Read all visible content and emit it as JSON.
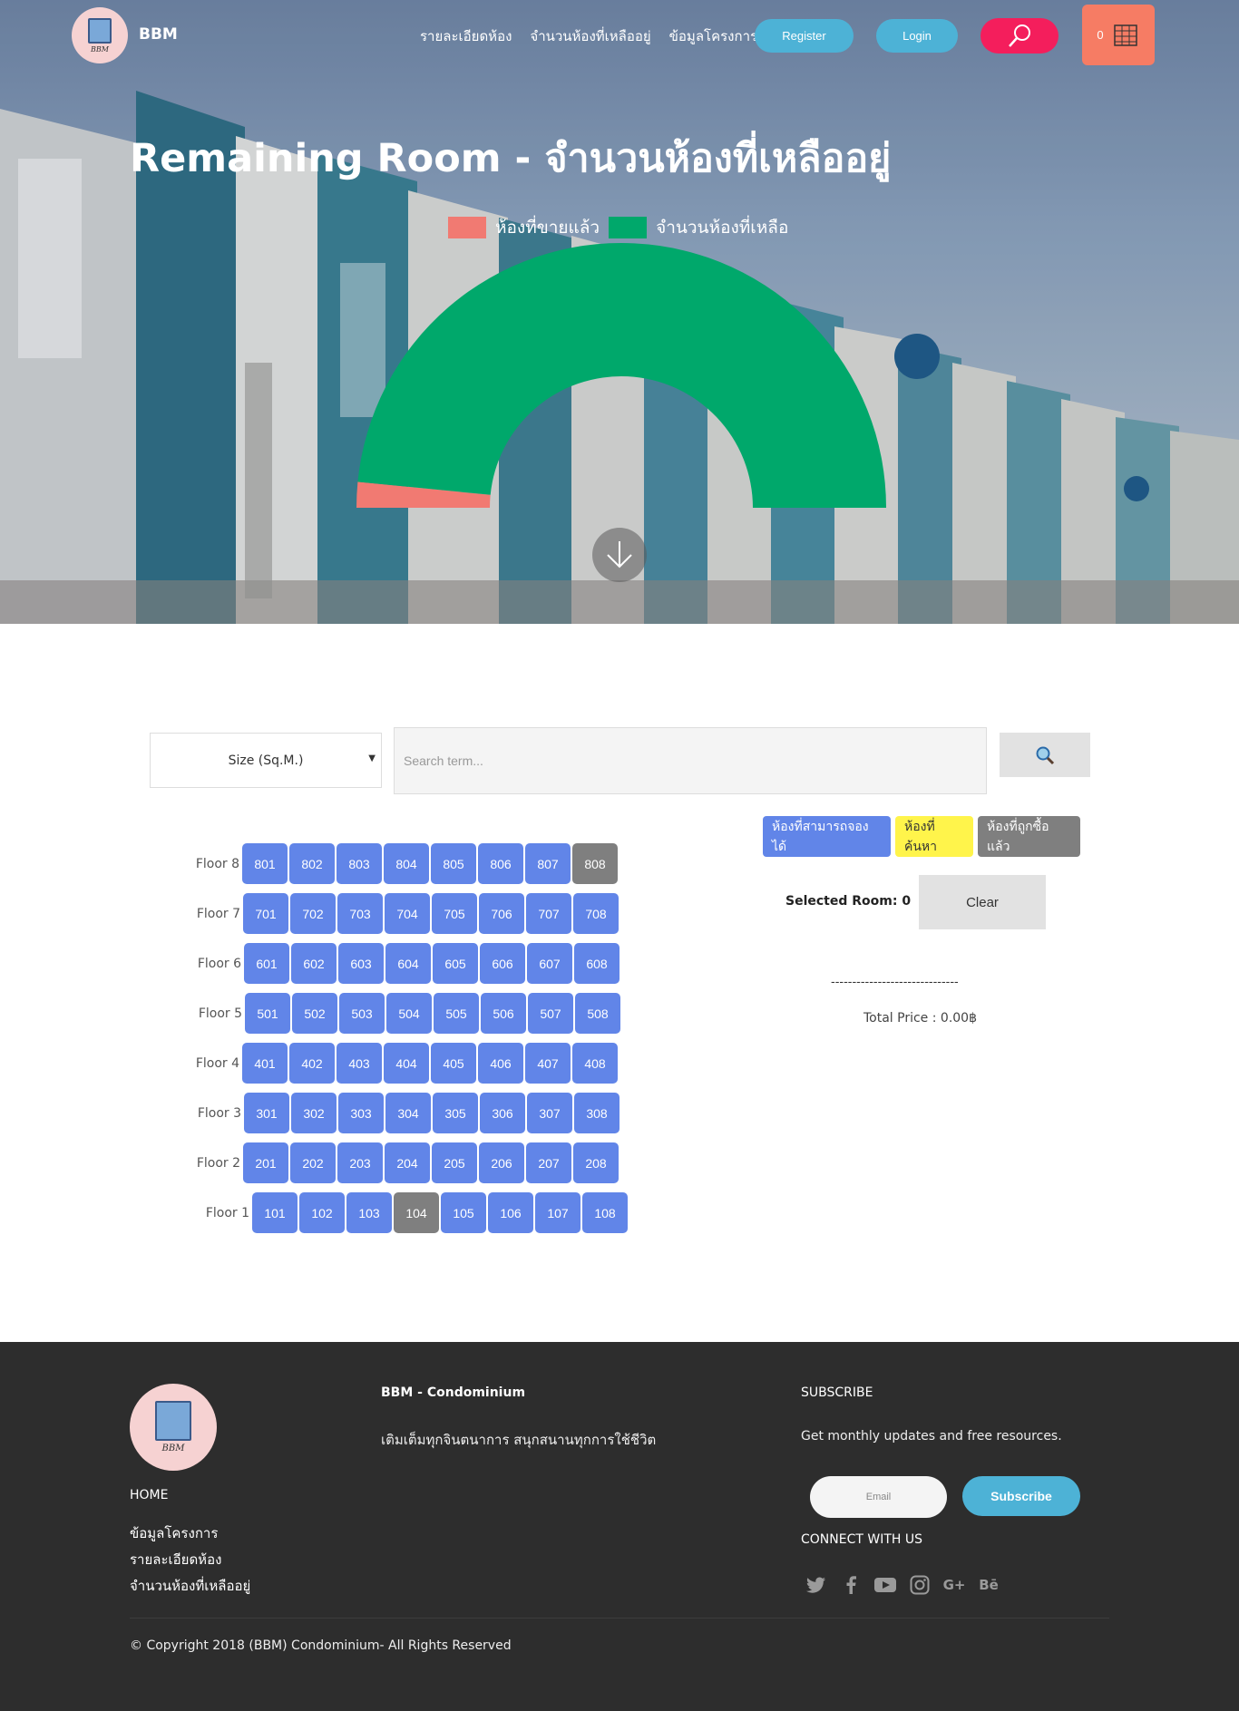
{
  "nav": {
    "brand": "BBM",
    "links": [
      "รายละเอียดห้อง",
      "จำนวนห้องที่เหลืออยู่",
      "ข้อมูลโครงการ"
    ],
    "register": "Register",
    "login": "Login",
    "cart_count": "0"
  },
  "hero": {
    "title": "Remaining Room - จำนวนห้องที่เหลืออยู่",
    "legend": [
      {
        "label": "ห้องที่ขายแล้ว",
        "color": "#f17a72"
      },
      {
        "label": "จำนวนห้องที่เหลือ",
        "color": "#00a86b"
      }
    ]
  },
  "chart_data": {
    "type": "pie",
    "subtype": "half-doughnut",
    "series": [
      {
        "name": "ห้องที่ขายแล้ว",
        "value": 2,
        "color": "#f17a72"
      },
      {
        "name": "จำนวนห้องที่เหลือ",
        "value": 62,
        "color": "#00a86b"
      }
    ]
  },
  "search": {
    "size_label": "Size (Sq.M.)",
    "placeholder": "Search term..."
  },
  "floors": [
    {
      "label": "Floor 8",
      "rooms": [
        "801",
        "802",
        "803",
        "804",
        "805",
        "806",
        "807",
        "808"
      ],
      "sold": [
        "808"
      ]
    },
    {
      "label": "Floor 7",
      "rooms": [
        "701",
        "702",
        "703",
        "704",
        "705",
        "706",
        "707",
        "708"
      ],
      "sold": []
    },
    {
      "label": "Floor 6",
      "rooms": [
        "601",
        "602",
        "603",
        "604",
        "605",
        "606",
        "607",
        "608"
      ],
      "sold": []
    },
    {
      "label": "Floor 5",
      "rooms": [
        "501",
        "502",
        "503",
        "504",
        "505",
        "506",
        "507",
        "508"
      ],
      "sold": []
    },
    {
      "label": "Floor 4",
      "rooms": [
        "401",
        "402",
        "403",
        "404",
        "405",
        "406",
        "407",
        "408"
      ],
      "sold": []
    },
    {
      "label": "Floor 3",
      "rooms": [
        "301",
        "302",
        "303",
        "304",
        "305",
        "306",
        "307",
        "308"
      ],
      "sold": []
    },
    {
      "label": "Floor 2",
      "rooms": [
        "201",
        "202",
        "203",
        "204",
        "205",
        "206",
        "207",
        "208"
      ],
      "sold": []
    },
    {
      "label": "Floor 1",
      "rooms": [
        "101",
        "102",
        "103",
        "104",
        "105",
        "106",
        "107",
        "108"
      ],
      "sold": [
        "104"
      ]
    }
  ],
  "status": {
    "available": "ห้องที่สามารถจองได้",
    "found": "ห้องที่ค้นหา",
    "sold": "ห้องที่ถูกซื้อแล้ว",
    "selected_room": "Selected Room: 0",
    "clear": "Clear",
    "divider": "------------------------------",
    "total_price": "Total Price : 0.00฿"
  },
  "footer": {
    "home": "HOME",
    "links": [
      "ข้อมูลโครงการ",
      "รายละเอียดห้อง",
      "จำนวนห้องที่เหลืออยู่"
    ],
    "brand": "BBM - Condominium",
    "tagline": "เติมเต็มทุกจินตนาการ สนุกสนานทุกการใช้ชีวิต",
    "subscribe_title": "SUBSCRIBE",
    "subscribe_text": "Get monthly updates and free resources.",
    "email_placeholder": "Email",
    "subscribe_button": "Subscribe",
    "connect": "CONNECT WITH US",
    "social": [
      "twitter-icon",
      "facebook-icon",
      "youtube-icon",
      "instagram-icon",
      "google-plus-icon",
      "behance-icon"
    ],
    "copyright": "© Copyright 2018 (BBM) Condominium- All Rights Reserved"
  }
}
